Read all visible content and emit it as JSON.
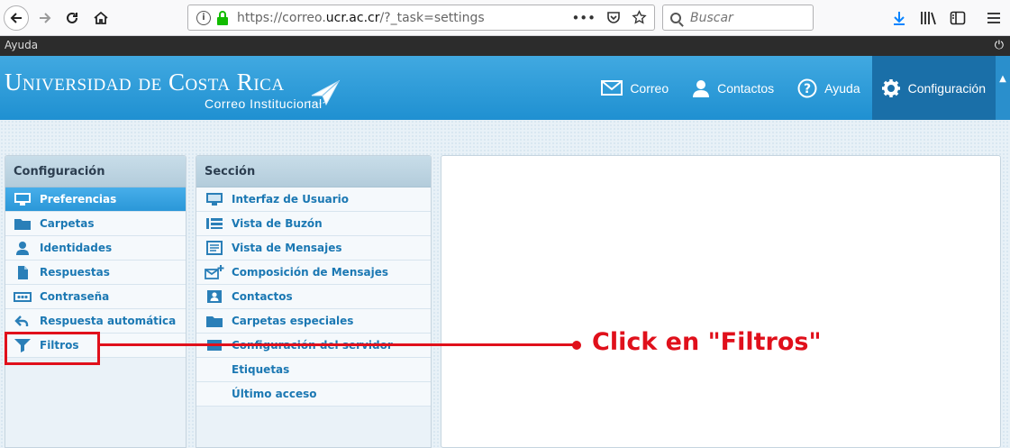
{
  "browser": {
    "url_prefix": "https://correo.",
    "url_domain": "ucr.ac.cr",
    "url_suffix": "/?_task=settings",
    "search_placeholder": "Buscar",
    "more_glyph": "•••"
  },
  "topbar": {
    "help_label": "Ayuda",
    "power_glyph": "⏻"
  },
  "header": {
    "brand_part1": "U",
    "brand_part1_sc": "NIVERSIDAD",
    "brand_part2": "DE",
    "brand_part3": "C",
    "brand_part3_sc": "OSTA",
    "brand_part4": "R",
    "brand_part4_sc": "ICA",
    "brand_subtitle": "Correo Institucional",
    "nav": [
      {
        "label": "Correo",
        "icon": "envelope-icon"
      },
      {
        "label": "Contactos",
        "icon": "person-icon"
      },
      {
        "label": "Ayuda",
        "icon": "help-icon"
      },
      {
        "label": "Configuración",
        "icon": "gear-icon",
        "active": true
      }
    ],
    "toggle_glyph": "▲"
  },
  "settings_panel": {
    "title": "Configuración",
    "items": [
      {
        "label": "Preferencias",
        "icon": "monitor-icon",
        "selected": true
      },
      {
        "label": "Carpetas",
        "icon": "folder-icon"
      },
      {
        "label": "Identidades",
        "icon": "user-icon"
      },
      {
        "label": "Respuestas",
        "icon": "document-icon"
      },
      {
        "label": "Contraseña",
        "icon": "password-icon"
      },
      {
        "label": "Respuesta automática",
        "icon": "reply-icon"
      },
      {
        "label": "Filtros",
        "icon": "filter-icon"
      }
    ]
  },
  "section_panel": {
    "title": "Sección",
    "items": [
      {
        "label": "Interfaz de Usuario",
        "icon": "monitor-icon"
      },
      {
        "label": "Vista de Buzón",
        "icon": "list-view-icon"
      },
      {
        "label": "Vista de Mensajes",
        "icon": "message-view-icon"
      },
      {
        "label": "Composición de Mensajes",
        "icon": "compose-icon"
      },
      {
        "label": "Contactos",
        "icon": "contacts-icon"
      },
      {
        "label": "Carpetas especiales",
        "icon": "folder-icon"
      },
      {
        "label": "Configuración del servidor",
        "icon": "server-icon"
      },
      {
        "label": "Etiquetas",
        "icon": ""
      },
      {
        "label": "Último acceso",
        "icon": ""
      }
    ]
  },
  "annotation": {
    "text": "Click en \"Filtros\"",
    "color": "#e0101b"
  },
  "colors": {
    "header_blue": "#2a9ad8",
    "selected_blue": "#3aa5e4",
    "link_blue": "#1b78b3"
  }
}
